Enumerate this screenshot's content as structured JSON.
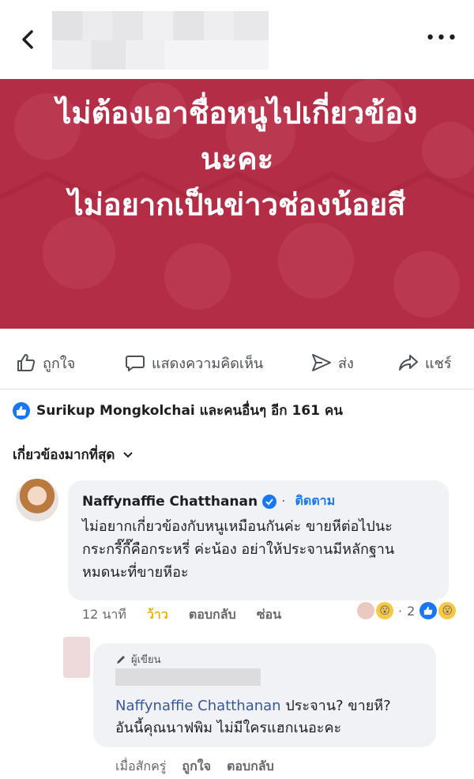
{
  "banner": {
    "lines": [
      "ไม่ต้องเอาชื่อหนูไปเกี่ยวข้อง",
      "นะคะ",
      "ไม่อยากเป็นข่าวช่องน้อยสี"
    ],
    "bg_color": "#b22d45"
  },
  "actions": {
    "like": "ถูกใจ",
    "comment": "แสดงความคิดเห็น",
    "send": "ส่ง",
    "share": "แชร์"
  },
  "reactions_summary": "Surikup Mongkolchai และคนอื่นๆ อีก 161 คน",
  "sort_label": "เกี่ยวข้องมากที่สุด",
  "comment": {
    "author": "Naffynaffie Chatthanan",
    "follow": "ติดตาม",
    "lines": [
      "ไม่อยากเกี่ยวข้องกับหนูเหมือนกันค่ะ ขายหีต่อไปนะ",
      "กระกรี๊กี๊คือกระหรี่ ค่ะน้อง อย่าให้ประจานมีหลักฐาน",
      "หมดนะที่ขายหีอะ"
    ],
    "time": "12 นาที",
    "reaction_label": "ว้าว",
    "reply": "ตอบกลับ",
    "hide": "ซ่อน",
    "reaction_count": "2"
  },
  "reply": {
    "author_tag": "ผู้เขียน",
    "mention": "Naffynaffie Chatthanan",
    "line1_rest": " ประจาน? ขายหี?",
    "line2": "อันนี้คุณนาฟพิม ไม่มีใครแฮกเนอะคะ",
    "time": "เมื่อสักครู่",
    "like": "ถูกใจ",
    "reply": "ตอบกลับ"
  },
  "colors": {
    "accent": "#1877f2",
    "wow": "#e8b51b"
  }
}
